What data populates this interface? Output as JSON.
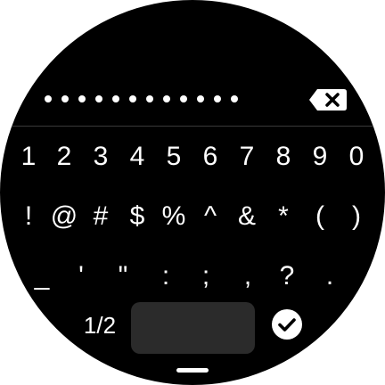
{
  "password": {
    "masked_length": 12,
    "mask_char": "•"
  },
  "icons": {
    "backspace": "backspace-icon",
    "done": "check-circle-icon"
  },
  "keyboard": {
    "rows": [
      [
        "1",
        "2",
        "3",
        "4",
        "5",
        "6",
        "7",
        "8",
        "9",
        "0"
      ],
      [
        "!",
        "@",
        "#",
        "$",
        "%",
        "^",
        "&",
        "*",
        "(",
        ")"
      ],
      [
        "_",
        "'",
        "\"",
        ":",
        ";",
        ",",
        "?",
        "."
      ]
    ],
    "page_indicator": "1/2"
  },
  "colors": {
    "background": "#000000",
    "key_text": "#ffffff",
    "space_key": "#2b2b2b",
    "divider": "#3a3a3a"
  }
}
